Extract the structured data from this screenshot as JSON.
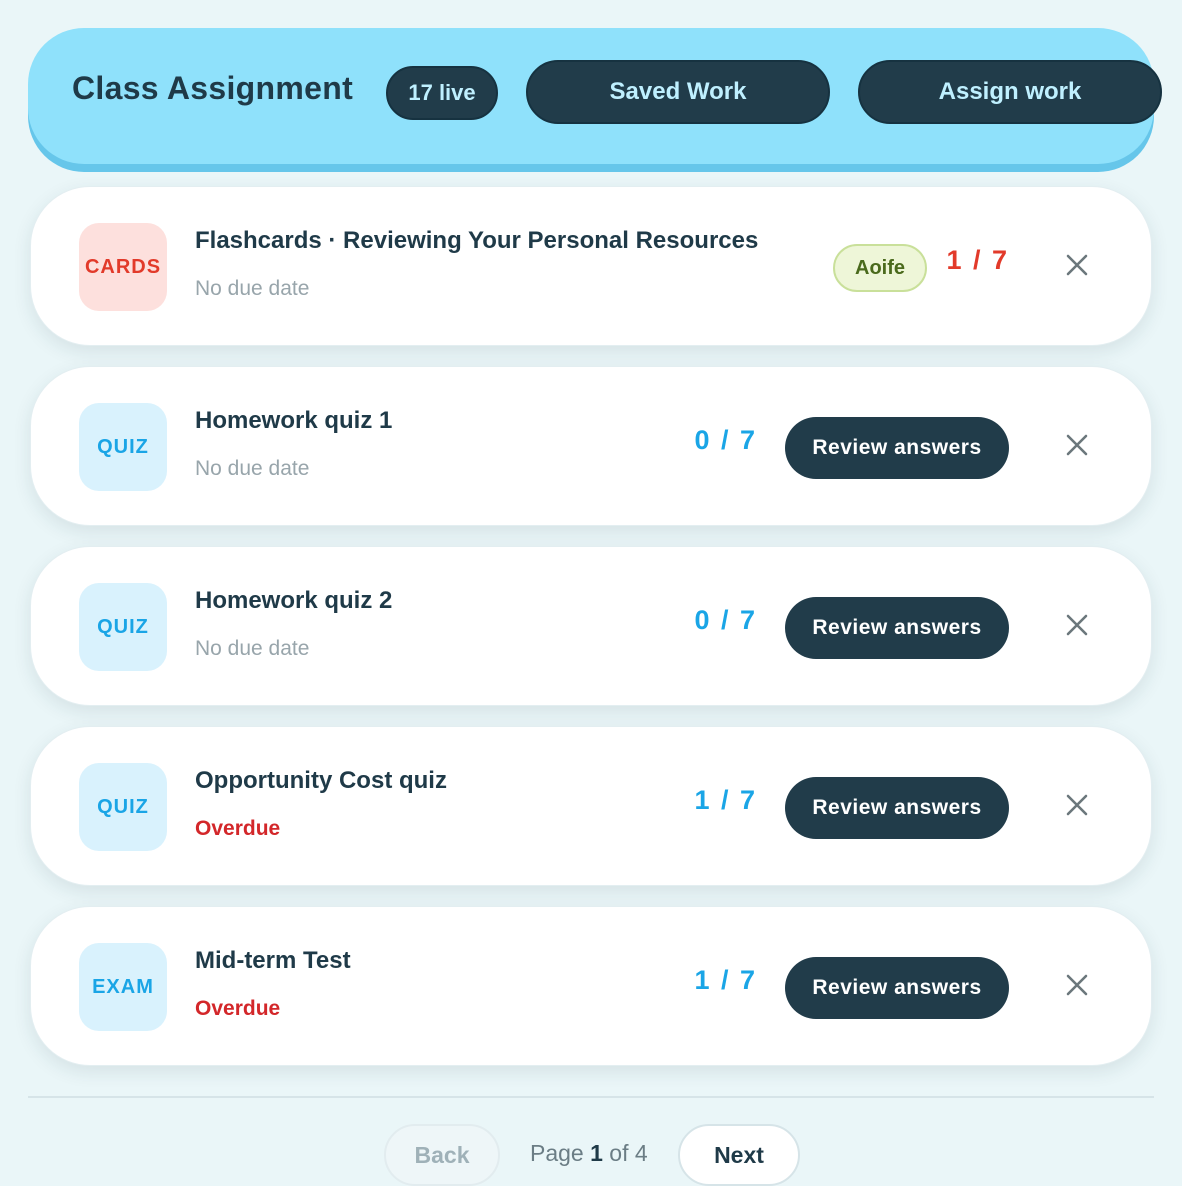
{
  "header": {
    "title": "Class Assignment",
    "live_count": "17 live",
    "saved_work_label": "Saved Work",
    "assign_work_label": "Assign work"
  },
  "assignments": [
    {
      "type": "CARDS",
      "title": "Flashcards · Reviewing Your Personal Resources",
      "subtitle": "No due date",
      "student": "Aoife",
      "score": "1 / 7"
    },
    {
      "type": "QUIZ",
      "title": "Homework quiz 1",
      "subtitle": "No due date",
      "score": "0 / 7",
      "action": "Review answers"
    },
    {
      "type": "QUIZ",
      "title": "Homework quiz 2",
      "subtitle": "No due date",
      "score": "0 / 7",
      "action": "Review answers"
    },
    {
      "type": "QUIZ",
      "title": "Opportunity Cost quiz",
      "subtitle": "Overdue",
      "score": "1 / 7",
      "action": "Review answers"
    },
    {
      "type": "EXAM",
      "title": "Mid-term Test",
      "subtitle": "Overdue",
      "score": "1 / 7",
      "action": "Review answers"
    }
  ],
  "pagination": {
    "back_label": "Back",
    "page_prefix": "Page",
    "current_page": "1",
    "of_label": "of",
    "total_pages": "4",
    "next_label": "Next"
  },
  "colors": {
    "header_bg": "#8fe1fb",
    "dark_button": "#213c4a",
    "quiz_accent": "#1aa5e6",
    "cards_accent": "#e23a2a",
    "overdue": "#d3272a"
  },
  "icons": {
    "remove": "close-icon"
  }
}
